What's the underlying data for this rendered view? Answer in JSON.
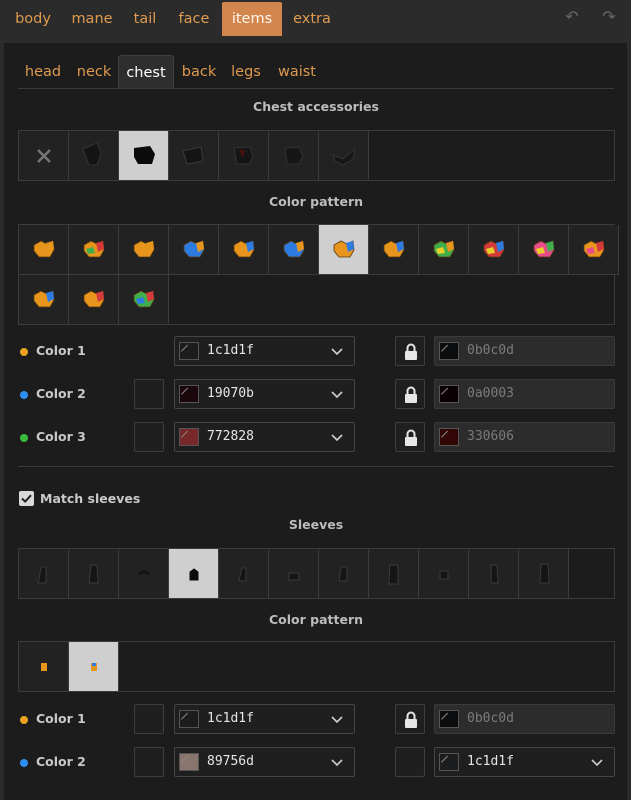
{
  "top_tabs": [
    {
      "label": "body"
    },
    {
      "label": "mane"
    },
    {
      "label": "tail"
    },
    {
      "label": "face"
    },
    {
      "label": "items"
    },
    {
      "label": "extra"
    }
  ],
  "active_top_tab": "items",
  "sub_tabs": [
    {
      "label": "head"
    },
    {
      "label": "neck"
    },
    {
      "label": "chest"
    },
    {
      "label": "back"
    },
    {
      "label": "legs"
    },
    {
      "label": "waist"
    }
  ],
  "active_sub_tab": "chest",
  "chest": {
    "title": "Chest accessories",
    "pattern_title": "Color pattern",
    "colors": [
      {
        "label": "Color 1",
        "dot": "#f0a020",
        "value": "1c1d1f",
        "swatch": "#1c1d1f",
        "locked_value": "0b0c0d",
        "locked_swatch": "#0b0c0d"
      },
      {
        "label": "Color 2",
        "dot": "#2d8ef0",
        "value": "19070b",
        "swatch": "#19070b",
        "locked_value": "0a0003",
        "locked_swatch": "#0a0003"
      },
      {
        "label": "Color 3",
        "dot": "#3dbb3d",
        "value": "772828",
        "swatch": "#772828",
        "locked_value": "330606",
        "locked_swatch": "#330606"
      }
    ]
  },
  "match_sleeves": {
    "label": "Match sleeves",
    "checked": true
  },
  "sleeves": {
    "title": "Sleeves",
    "pattern_title": "Color pattern",
    "colors": [
      {
        "label": "Color 1",
        "dot": "#f0a020",
        "value": "1c1d1f",
        "swatch": "#1c1d1f",
        "locked_value": "0b0c0d",
        "locked_swatch": "#0b0c0d"
      },
      {
        "label": "Color 2",
        "dot": "#2d8ef0",
        "value": "89756d",
        "swatch": "#89756d",
        "right_value": "1c1d1f",
        "right_swatch": "#1c1d1f"
      }
    ]
  },
  "icons": {
    "undo": "undo-icon",
    "redo": "redo-icon",
    "lock": "lock-icon",
    "none": "close-icon",
    "chevron": "chevron-down-icon"
  }
}
